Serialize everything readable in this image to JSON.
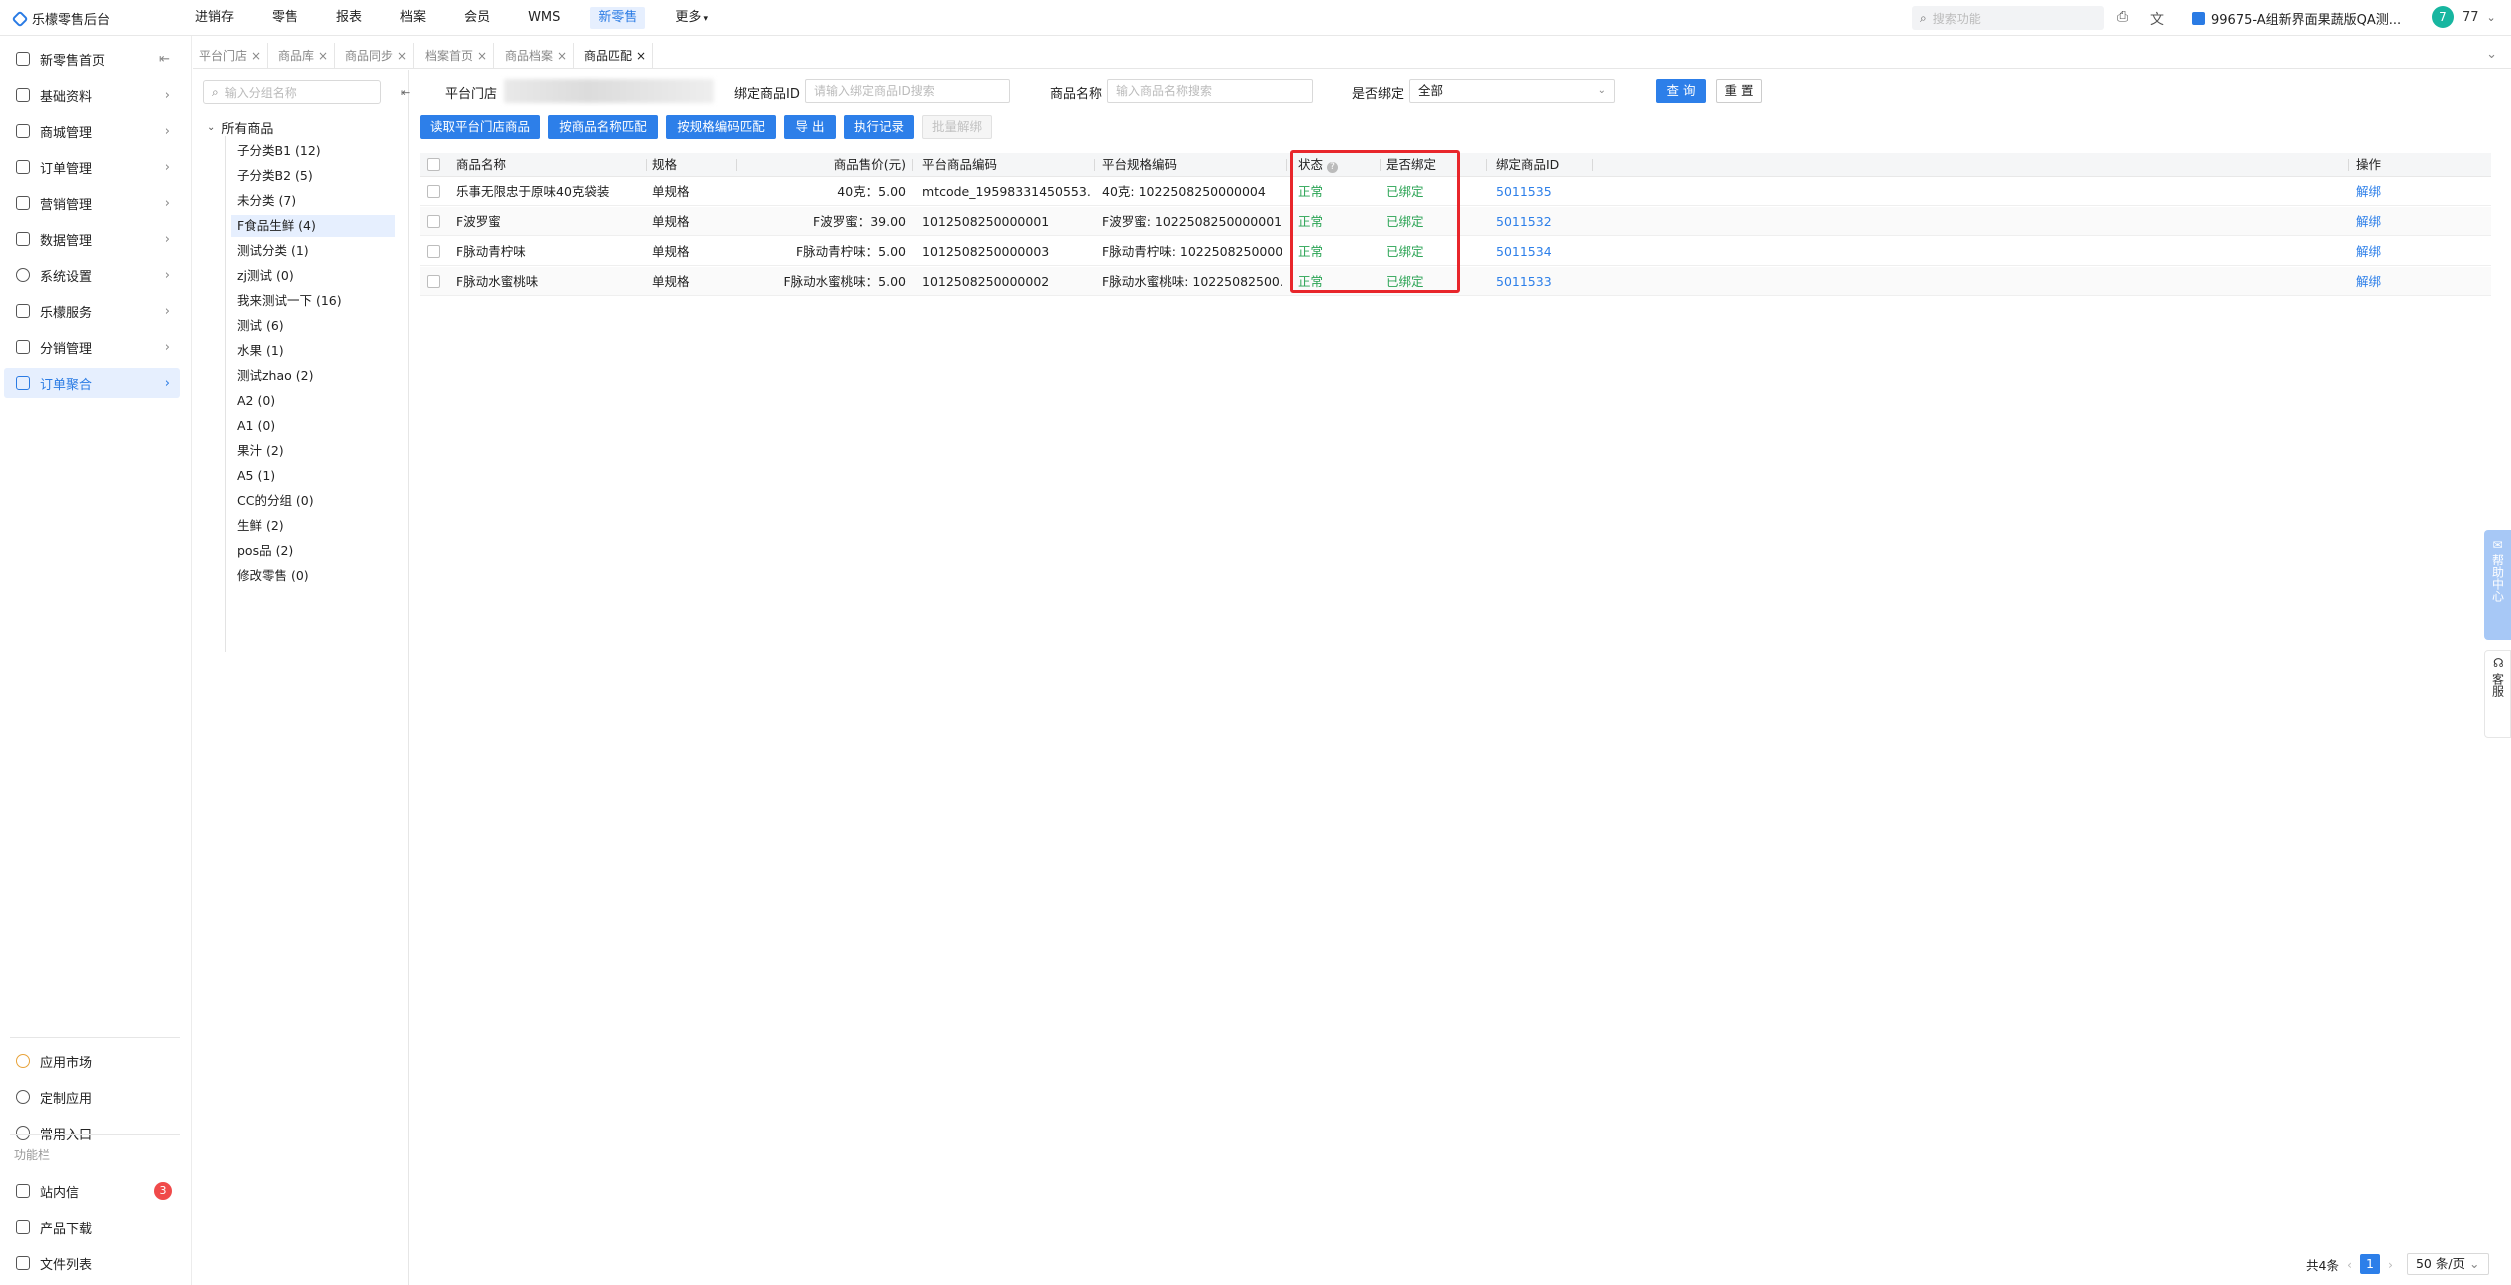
{
  "app": {
    "title": "乐檬零售后台"
  },
  "topnav": [
    "进销存",
    "零售",
    "报表",
    "档案",
    "会员",
    "WMS",
    "新零售",
    "更多"
  ],
  "topnav_active": "新零售",
  "search": {
    "placeholder": "搜索功能"
  },
  "org": {
    "name": "99675-A组新界面果蔬版QA测..."
  },
  "user": {
    "avatar": "7",
    "name": "77"
  },
  "sidebar": {
    "items": [
      {
        "label": "新零售首页",
        "icon": "home-icon"
      },
      {
        "label": "基础资料",
        "icon": "grid-icon"
      },
      {
        "label": "商城管理",
        "icon": "shop-icon"
      },
      {
        "label": "订单管理",
        "icon": "order-icon"
      },
      {
        "label": "营销管理",
        "icon": "marketing-icon"
      },
      {
        "label": "数据管理",
        "icon": "chart-icon"
      },
      {
        "label": "系统设置",
        "icon": "gear-icon"
      },
      {
        "label": "乐檬服务",
        "icon": "service-icon"
      },
      {
        "label": "分销管理",
        "icon": "distribution-icon"
      },
      {
        "label": "订单聚合",
        "icon": "aggregate-icon"
      }
    ],
    "active": "订单聚合",
    "bottom": [
      {
        "label": "应用市场",
        "icon": "app-market-icon"
      },
      {
        "label": "定制应用",
        "icon": "custom-app-icon"
      },
      {
        "label": "常用入口",
        "icon": "heart-icon"
      }
    ],
    "section_label": "功能栏",
    "tools": [
      {
        "label": "站内信",
        "icon": "mail-icon",
        "badge": "3"
      },
      {
        "label": "产品下载",
        "icon": "download-icon"
      },
      {
        "label": "文件列表",
        "icon": "file-list-icon"
      }
    ]
  },
  "tabs": [
    {
      "label": "平台门店"
    },
    {
      "label": "商品库"
    },
    {
      "label": "商品同步"
    },
    {
      "label": "档案首页"
    },
    {
      "label": "商品档案"
    },
    {
      "label": "商品匹配"
    }
  ],
  "tabs_active": "商品匹配",
  "tree": {
    "search_placeholder": "输入分组名称",
    "root": "所有商品",
    "nodes": [
      "子分类B1 (12)",
      "子分类B2 (5)",
      "未分类 (7)",
      "F食品生鲜 (4)",
      "测试分类 (1)",
      "zj测试 (0)",
      "我来测试一下 (16)",
      "测试 (6)",
      "水果 (1)",
      "测试zhao (2)",
      "A2 (0)",
      "A1 (0)",
      "果汁 (2)",
      "A5 (1)",
      "CC的分组 (0)",
      "生鲜 (2)",
      "pos品 (2)",
      "修改零售 (0)"
    ],
    "active": "F食品生鲜 (4)"
  },
  "filters": {
    "store_label": "平台门店",
    "bind_id_label": "绑定商品ID",
    "bind_id_placeholder": "请输入绑定商品ID搜索",
    "name_label": "商品名称",
    "name_placeholder": "输入商品名称搜索",
    "bound_label": "是否绑定",
    "bound_value": "全部",
    "query": "查 询",
    "reset": "重 置"
  },
  "actions": [
    "读取平台门店商品",
    "按商品名称匹配",
    "按规格编码匹配",
    "导 出",
    "执行记录",
    "批量解绑"
  ],
  "table": {
    "columns": [
      "商品名称",
      "规格",
      "商品售价(元)",
      "平台商品编码",
      "平台规格编码",
      "状态",
      "是否绑定",
      "绑定商品ID",
      "操作"
    ],
    "rows": [
      {
        "name": "乐事无限忠于原味40克袋装",
        "spec": "单规格",
        "price": "40克：5.00",
        "code": "mtcode_19598331450553...",
        "spec_code": "40克: 1022508250000004",
        "status": "正常",
        "bound": "已绑定",
        "bind_id": "5011535",
        "op": "解绑"
      },
      {
        "name": "F波罗蜜",
        "spec": "单规格",
        "price": "F波罗蜜：39.00",
        "code": "1012508250000001",
        "spec_code": "F波罗蜜: 1022508250000001",
        "status": "正常",
        "bound": "已绑定",
        "bind_id": "5011532",
        "op": "解绑"
      },
      {
        "name": "F脉动青柠味",
        "spec": "单规格",
        "price": "F脉动青柠味：5.00",
        "code": "1012508250000003",
        "spec_code": "F脉动青柠味: 1022508250000...",
        "status": "正常",
        "bound": "已绑定",
        "bind_id": "5011534",
        "op": "解绑"
      },
      {
        "name": "F脉动水蜜桃味",
        "spec": "单规格",
        "price": "F脉动水蜜桃味：5.00",
        "code": "1012508250000002",
        "spec_code": "F脉动水蜜桃味: 10225082500...",
        "status": "正常",
        "bound": "已绑定",
        "bind_id": "5011533",
        "op": "解绑"
      }
    ]
  },
  "pager": {
    "total": "共4条",
    "page": "1",
    "size": "50 条/页"
  },
  "float": {
    "help": "帮助中心",
    "cs": "客服"
  },
  "colors": {
    "primary": "#2d7fe9",
    "success": "#2aa354",
    "highlight": "#e8262b"
  }
}
